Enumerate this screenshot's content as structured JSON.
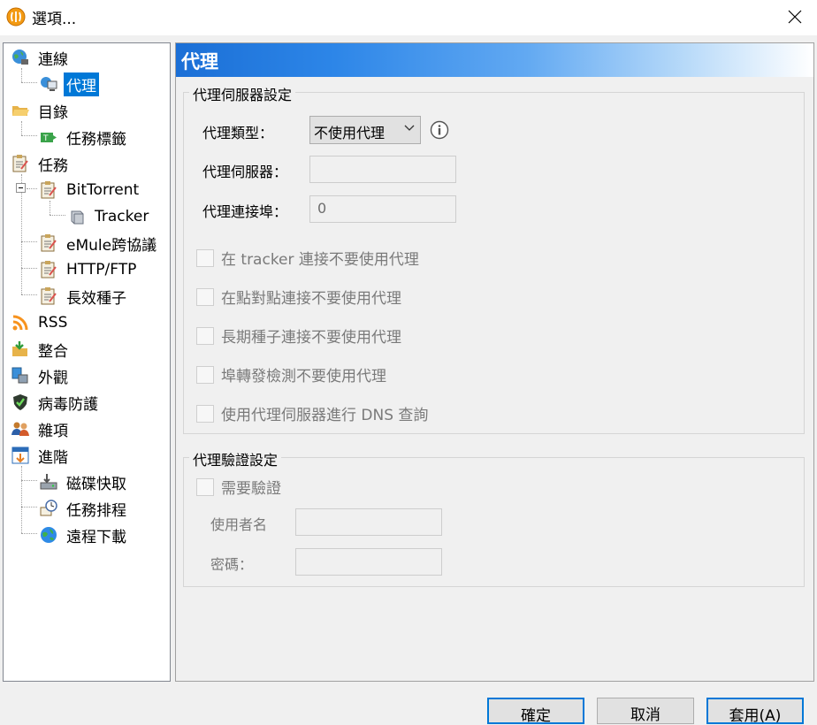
{
  "window": {
    "title": "選項...",
    "app_icon": "qbittorrent-icon",
    "close_icon": "close-icon"
  },
  "tree": {
    "items": [
      {
        "label": "連線",
        "icon": "globe-network-icon"
      },
      {
        "label": "代理",
        "icon": "proxy-computer-icon",
        "selected": true
      },
      {
        "label": "目錄",
        "icon": "folder-open-icon"
      },
      {
        "label": "任務標籤",
        "icon": "tag-icon"
      },
      {
        "label": "任務",
        "icon": "clipboard-task-icon"
      },
      {
        "label": "BitTorrent",
        "icon": "clipboard-task-icon",
        "expanded": true
      },
      {
        "label": "Tracker",
        "icon": "server-icon"
      },
      {
        "label": "eMule跨協議",
        "icon": "clipboard-task-icon"
      },
      {
        "label": "HTTP/FTP",
        "icon": "clipboard-task-icon"
      },
      {
        "label": "長效種子",
        "icon": "clipboard-task-icon"
      },
      {
        "label": "RSS",
        "icon": "rss-icon"
      },
      {
        "label": "整合",
        "icon": "folder-arrow-icon"
      },
      {
        "label": "外觀",
        "icon": "appearance-icon"
      },
      {
        "label": "病毒防護",
        "icon": "shield-icon"
      },
      {
        "label": "雜項",
        "icon": "users-icon"
      },
      {
        "label": "進階",
        "icon": "advanced-window-icon"
      },
      {
        "label": "磁碟快取",
        "icon": "disk-cache-icon"
      },
      {
        "label": "任務排程",
        "icon": "scheduler-icon"
      },
      {
        "label": "遠程下載",
        "icon": "remote-globe-icon"
      }
    ]
  },
  "panel": {
    "title": "代理",
    "proxy_group": {
      "title": "代理伺服器設定",
      "type_label": "代理類型：",
      "type_value": "不使用代理",
      "server_label": "代理伺服器：",
      "server_value": "",
      "port_label": "代理連接埠：",
      "port_value": "0",
      "checkboxes": [
        {
          "label": "在 tracker 連接不要使用代理",
          "checked": false
        },
        {
          "label": "在點對點連接不要使用代理",
          "checked": false
        },
        {
          "label": "長期種子連接不要使用代理",
          "checked": false
        },
        {
          "label": "埠轉發檢測不要使用代理",
          "checked": false
        },
        {
          "label": "使用代理伺服器進行 DNS 查詢",
          "checked": false
        }
      ]
    },
    "auth_group": {
      "title": "代理驗證設定",
      "require_label": "需要驗證",
      "require_checked": false,
      "username_label": "使用者名",
      "username_value": "",
      "password_label": "密碼：",
      "password_value": ""
    }
  },
  "buttons": {
    "ok": "確定",
    "cancel": "取消",
    "apply": "套用(A)"
  },
  "colors": {
    "selection": "#0078d7",
    "header_start": "#1b6fd6",
    "header_end": "#ffffff"
  }
}
